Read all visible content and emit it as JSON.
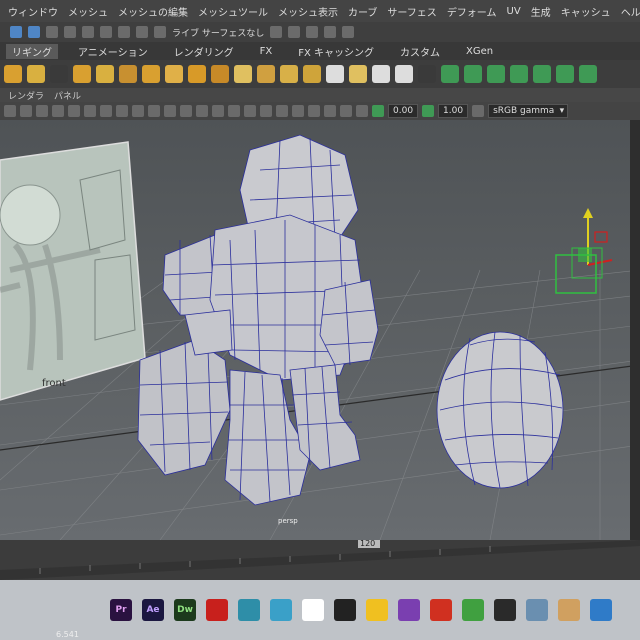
{
  "menubar": {
    "items": [
      "ウィンドウ",
      "メッシュ",
      "メッシュの編集",
      "メッシュツール",
      "メッシュ表示",
      "カーブ",
      "サーフェス",
      "デフォーム",
      "UV",
      "生成",
      "キャッシュ",
      "ヘルプ"
    ]
  },
  "toolbar": {
    "live_surface_label": "ライブ サーフェスなし"
  },
  "shelf_tabs": {
    "tabs": [
      "リギング",
      "アニメーション",
      "レンダリング",
      "FX",
      "FX キャッシング",
      "カスタム",
      "XGen"
    ]
  },
  "viewport_menu": {
    "items": [
      "レンダラ",
      "パネル"
    ]
  },
  "viewport_toolbar": {
    "field1": "0.00",
    "field2": "1.00",
    "colorspace": "sRGB gamma"
  },
  "viewport": {
    "image_plane_label": "front",
    "camera_label": "persp"
  },
  "timeslider": {
    "frame_marker": "120"
  },
  "statusbar": {
    "value": "6.541"
  },
  "taskbar": {
    "apps": [
      {
        "label": "Pr",
        "color": "#2a1240"
      },
      {
        "label": "Ae",
        "color": "#1b1740"
      },
      {
        "label": "Dw",
        "color": "#1c3a1c"
      },
      {
        "label": "",
        "color": "#c8201c"
      },
      {
        "label": "",
        "color": "#2e8ea8"
      },
      {
        "label": "",
        "color": "#3aa0c8"
      },
      {
        "label": "",
        "color": "#ffffff"
      },
      {
        "label": "",
        "color": "#222222"
      },
      {
        "label": "",
        "color": "#f0c020"
      },
      {
        "label": "",
        "color": "#7a3fb0"
      },
      {
        "label": "",
        "color": "#d03020"
      },
      {
        "label": "",
        "color": "#40a040"
      },
      {
        "label": "",
        "color": "#2a2a2a"
      },
      {
        "label": "",
        "color": "#6a8fb0"
      },
      {
        "label": "",
        "color": "#d0a060"
      },
      {
        "label": "",
        "color": "#2f7bc8"
      }
    ]
  }
}
